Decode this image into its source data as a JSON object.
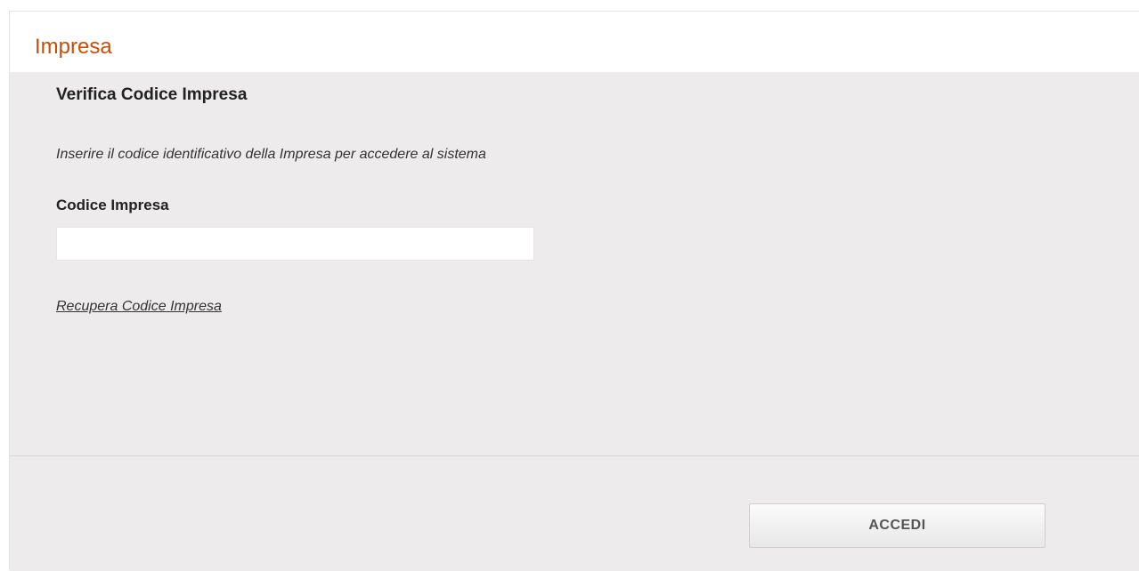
{
  "header": {
    "title": "Impresa"
  },
  "form": {
    "section_title": "Verifica Codice Impresa",
    "instructions": "Inserire il codice identificativo della Impresa per accedere al sistema",
    "code_label": "Codice Impresa",
    "code_value": "",
    "code_placeholder": "",
    "recover_link": "Recupera Codice Impresa"
  },
  "footer": {
    "submit_label": "ACCEDI"
  },
  "colors": {
    "accent": "#c94d0a",
    "panel_background": "#edebeb",
    "header_background": "#ffffff"
  }
}
